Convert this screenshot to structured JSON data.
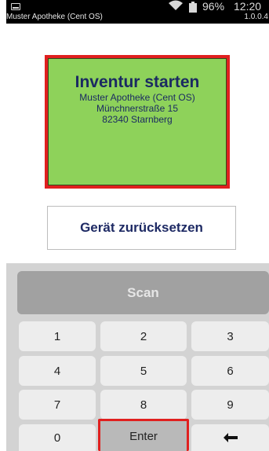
{
  "status_bar": {
    "app_name": "Muster Apotheke (Cent OS)",
    "version": "1.0.0.4",
    "battery_percent": "96%",
    "time": "12:20",
    "icons": [
      "notification-icon",
      "wifi-icon",
      "battery-icon"
    ]
  },
  "start_panel": {
    "title": "Inventur starten",
    "pharmacy_name": "Muster Apotheke (Cent OS)",
    "street": "Münchnerstraße 15",
    "city": "82340 Starnberg"
  },
  "reset_button": {
    "label": "Gerät zurücksetzen"
  },
  "keyboard": {
    "scan_label": "Scan",
    "keys": [
      "1",
      "2",
      "3",
      "4",
      "5",
      "6",
      "7",
      "8",
      "9",
      "0",
      "Enter"
    ],
    "backspace_icon": "left-arrow-icon"
  },
  "colors": {
    "start_panel_bg": "#8ed25a",
    "highlight_border": "#e0201f",
    "text_navy": "#1b2a62",
    "keyboard_bg": "#d3d3d3",
    "scan_bg": "#a1a1a1"
  }
}
